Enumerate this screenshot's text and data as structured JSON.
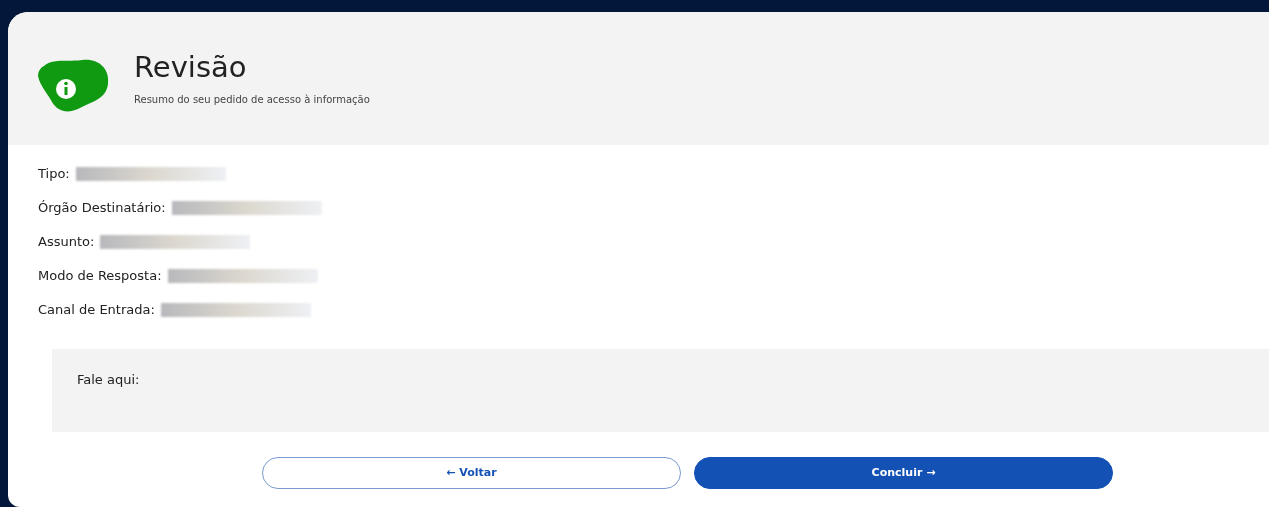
{
  "header": {
    "title": "Revisão",
    "subtitle": "Resumo do seu pedido de acesso à informação"
  },
  "fields": [
    {
      "label": "Tipo:"
    },
    {
      "label": "Órgão Destinatário:"
    },
    {
      "label": "Assunto:"
    },
    {
      "label": "Modo de Resposta:"
    },
    {
      "label": "Canal de Entrada:"
    }
  ],
  "message_box": {
    "label": "Fale aqui:"
  },
  "buttons": [
    {
      "kind": "secondary",
      "label": "← Voltar"
    },
    {
      "kind": "primary",
      "label": "Concluir →"
    }
  ]
}
